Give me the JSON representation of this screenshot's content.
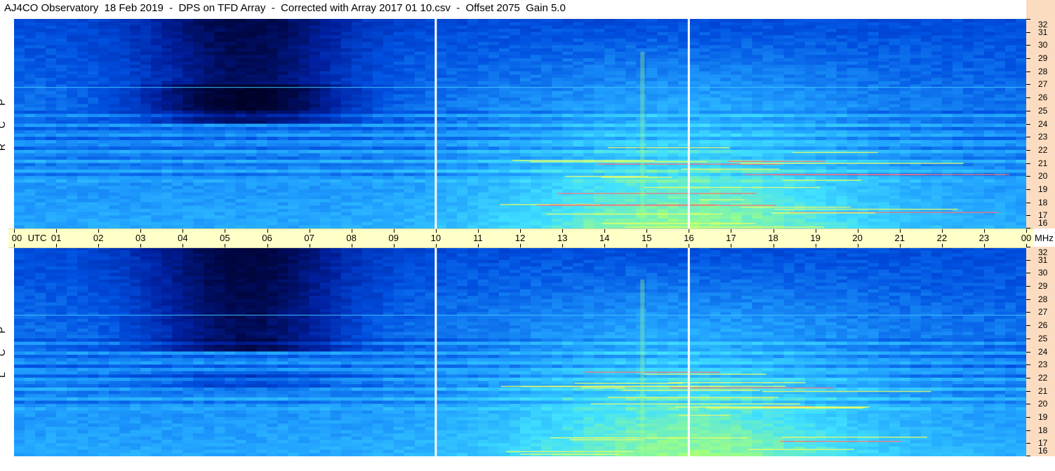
{
  "header": {
    "title": "AJ4CO Observatory  18 Feb 2019  -  DPS on TFD Array  -  Corrected with Array 2017 01 10.csv  -  Offset 2075  Gain 5.0"
  },
  "chart_data": {
    "type": "heatmap",
    "panels": [
      {
        "name": "RCP",
        "label_letters": [
          "P",
          "C",
          "R"
        ]
      },
      {
        "name": "LCP",
        "label_letters": [
          "P",
          "C",
          "L"
        ]
      }
    ],
    "x_axis": {
      "unit_label": "UTC",
      "range_hours": [
        0,
        24
      ],
      "tick_labels": [
        "00",
        "01",
        "02",
        "03",
        "04",
        "05",
        "06",
        "07",
        "08",
        "09",
        "10",
        "11",
        "12",
        "13",
        "14",
        "15",
        "16",
        "17",
        "18",
        "19",
        "20",
        "21",
        "22",
        "23",
        "00"
      ]
    },
    "y_axis": {
      "unit_label": "MHz",
      "range_mhz": [
        16,
        32
      ],
      "tick_labels": [
        "32",
        "31",
        "30",
        "29",
        "28",
        "27",
        "26",
        "25",
        "24",
        "23",
        "22",
        "21",
        "20",
        "19",
        "18",
        "17",
        "16"
      ]
    },
    "gap_lines_utc": [
      10,
      16
    ],
    "colormap": [
      "#000020",
      "#00084a",
      "#0020a0",
      "#0050e0",
      "#20a0ff",
      "#40e0ff",
      "#a0ff80",
      "#ffff40",
      "#ff6060",
      "#ffffff"
    ],
    "axis_colors": {
      "time_axis_bg": "#ffffc8",
      "freq_axis_bg": "#fbdcc0"
    }
  }
}
